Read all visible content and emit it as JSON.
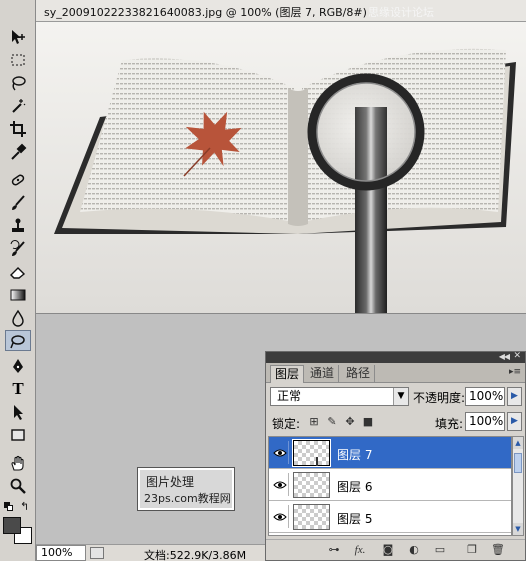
{
  "window": {
    "title": "sy_20091022233821640083.jpg @ 100% (图层 7, RGB/8#)",
    "watermark": "思缘设计论坛"
  },
  "toolbox": {
    "tools": [
      {
        "name": "move-tool-icon"
      },
      {
        "name": "marquee-tool-icon"
      },
      {
        "name": "lasso-tool-icon"
      },
      {
        "name": "magic-wand-tool-icon"
      },
      {
        "name": "crop-tool-icon"
      },
      {
        "name": "eyedropper-tool-icon"
      },
      {
        "name": "healing-brush-tool-icon"
      },
      {
        "name": "brush-tool-icon"
      },
      {
        "name": "clone-stamp-tool-icon"
      },
      {
        "name": "history-brush-tool-icon"
      },
      {
        "name": "eraser-tool-icon"
      },
      {
        "name": "gradient-tool-icon"
      },
      {
        "name": "blur-tool-icon"
      },
      {
        "name": "dodge-tool-icon"
      },
      {
        "name": "pen-tool-icon"
      },
      {
        "name": "type-tool-icon",
        "label": "T"
      },
      {
        "name": "path-selection-tool-icon"
      },
      {
        "name": "shape-tool-icon"
      },
      {
        "name": "hand-tool-icon"
      },
      {
        "name": "zoom-tool-icon"
      }
    ],
    "foreground_color": "#4a4a4a",
    "background_color": "#ffffff"
  },
  "workspace": {
    "watermark_line1": "图片处理",
    "watermark_line2": "23ps.com教程网"
  },
  "status": {
    "zoom": "100%",
    "doc_info": "文档:522.9K/3.86M"
  },
  "layers_panel": {
    "tabs": [
      {
        "label": "图层",
        "active": true
      },
      {
        "label": "通道",
        "active": false
      },
      {
        "label": "路径",
        "active": false
      }
    ],
    "blend_mode": "正常",
    "opacity_label": "不透明度:",
    "opacity_value": "100%",
    "lock_label": "锁定:",
    "fill_label": "填充:",
    "fill_value": "100%",
    "layers": [
      {
        "name": "图层 7",
        "selected": true,
        "visible": true
      },
      {
        "name": "图层 6",
        "selected": false,
        "visible": true
      },
      {
        "name": "图层 5",
        "selected": false,
        "visible": true
      }
    ],
    "bottom_icons": [
      "link-icon",
      "fx-icon",
      "mask-icon",
      "adjustment-icon",
      "group-icon",
      "new-layer-icon",
      "trash-icon"
    ],
    "fx_label": "fx."
  },
  "colors": {
    "selection": "#3169c6",
    "panel_bg": "#d6d3ce",
    "workspace": "#c0c0c0"
  }
}
